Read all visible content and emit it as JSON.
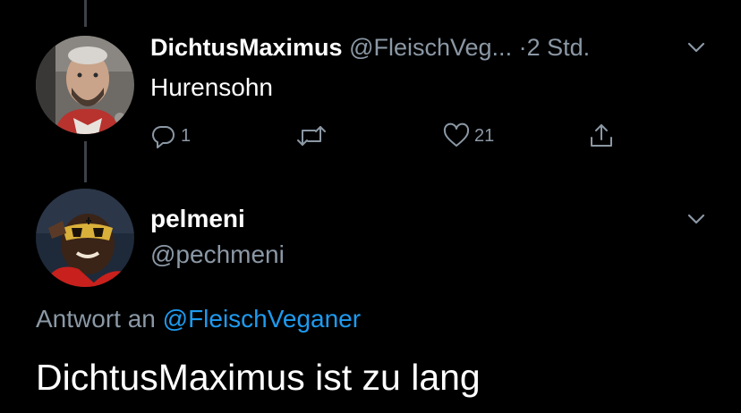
{
  "thread": {
    "tweet": {
      "display_name": "DichtusMaximus",
      "handle": "@FleischVeg...",
      "separator": "·",
      "time": "2 Std.",
      "text": "Hurensohn",
      "reply_count": "1",
      "retweet_count": "",
      "like_count": "21"
    },
    "reply": {
      "display_name": "pelmeni",
      "handle": "@pechmeni",
      "reply_to_prefix": "Antwort an",
      "reply_to_handle": "@FleischVeganer",
      "text": "DichtusMaximus ist zu lang"
    }
  },
  "icons": {
    "reply": "reply-icon",
    "retweet": "retweet-icon",
    "like": "heart-icon",
    "share": "share-icon",
    "more": "chevron-down-icon"
  },
  "colors": {
    "background": "#000000",
    "text": "#ffffff",
    "secondary": "#8b98a5",
    "link": "#1d9bf0"
  }
}
